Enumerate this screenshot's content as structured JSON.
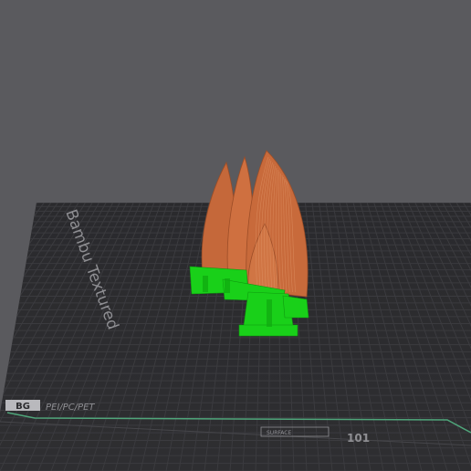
{
  "viewport": {
    "background_color": "#5a5a5e",
    "bed_color": "#2b2b2e",
    "grid_color": "#3d3d41",
    "bed_edge_color": "#4fa57a",
    "model_color": "#c5683a",
    "support_color": "#19d019"
  },
  "bed": {
    "brand_label": "Bambu Textured",
    "plate_type_label": "PEI/PC/PET",
    "corner_badge": "BG",
    "center_label": "101",
    "small_label": "SURFACE"
  }
}
